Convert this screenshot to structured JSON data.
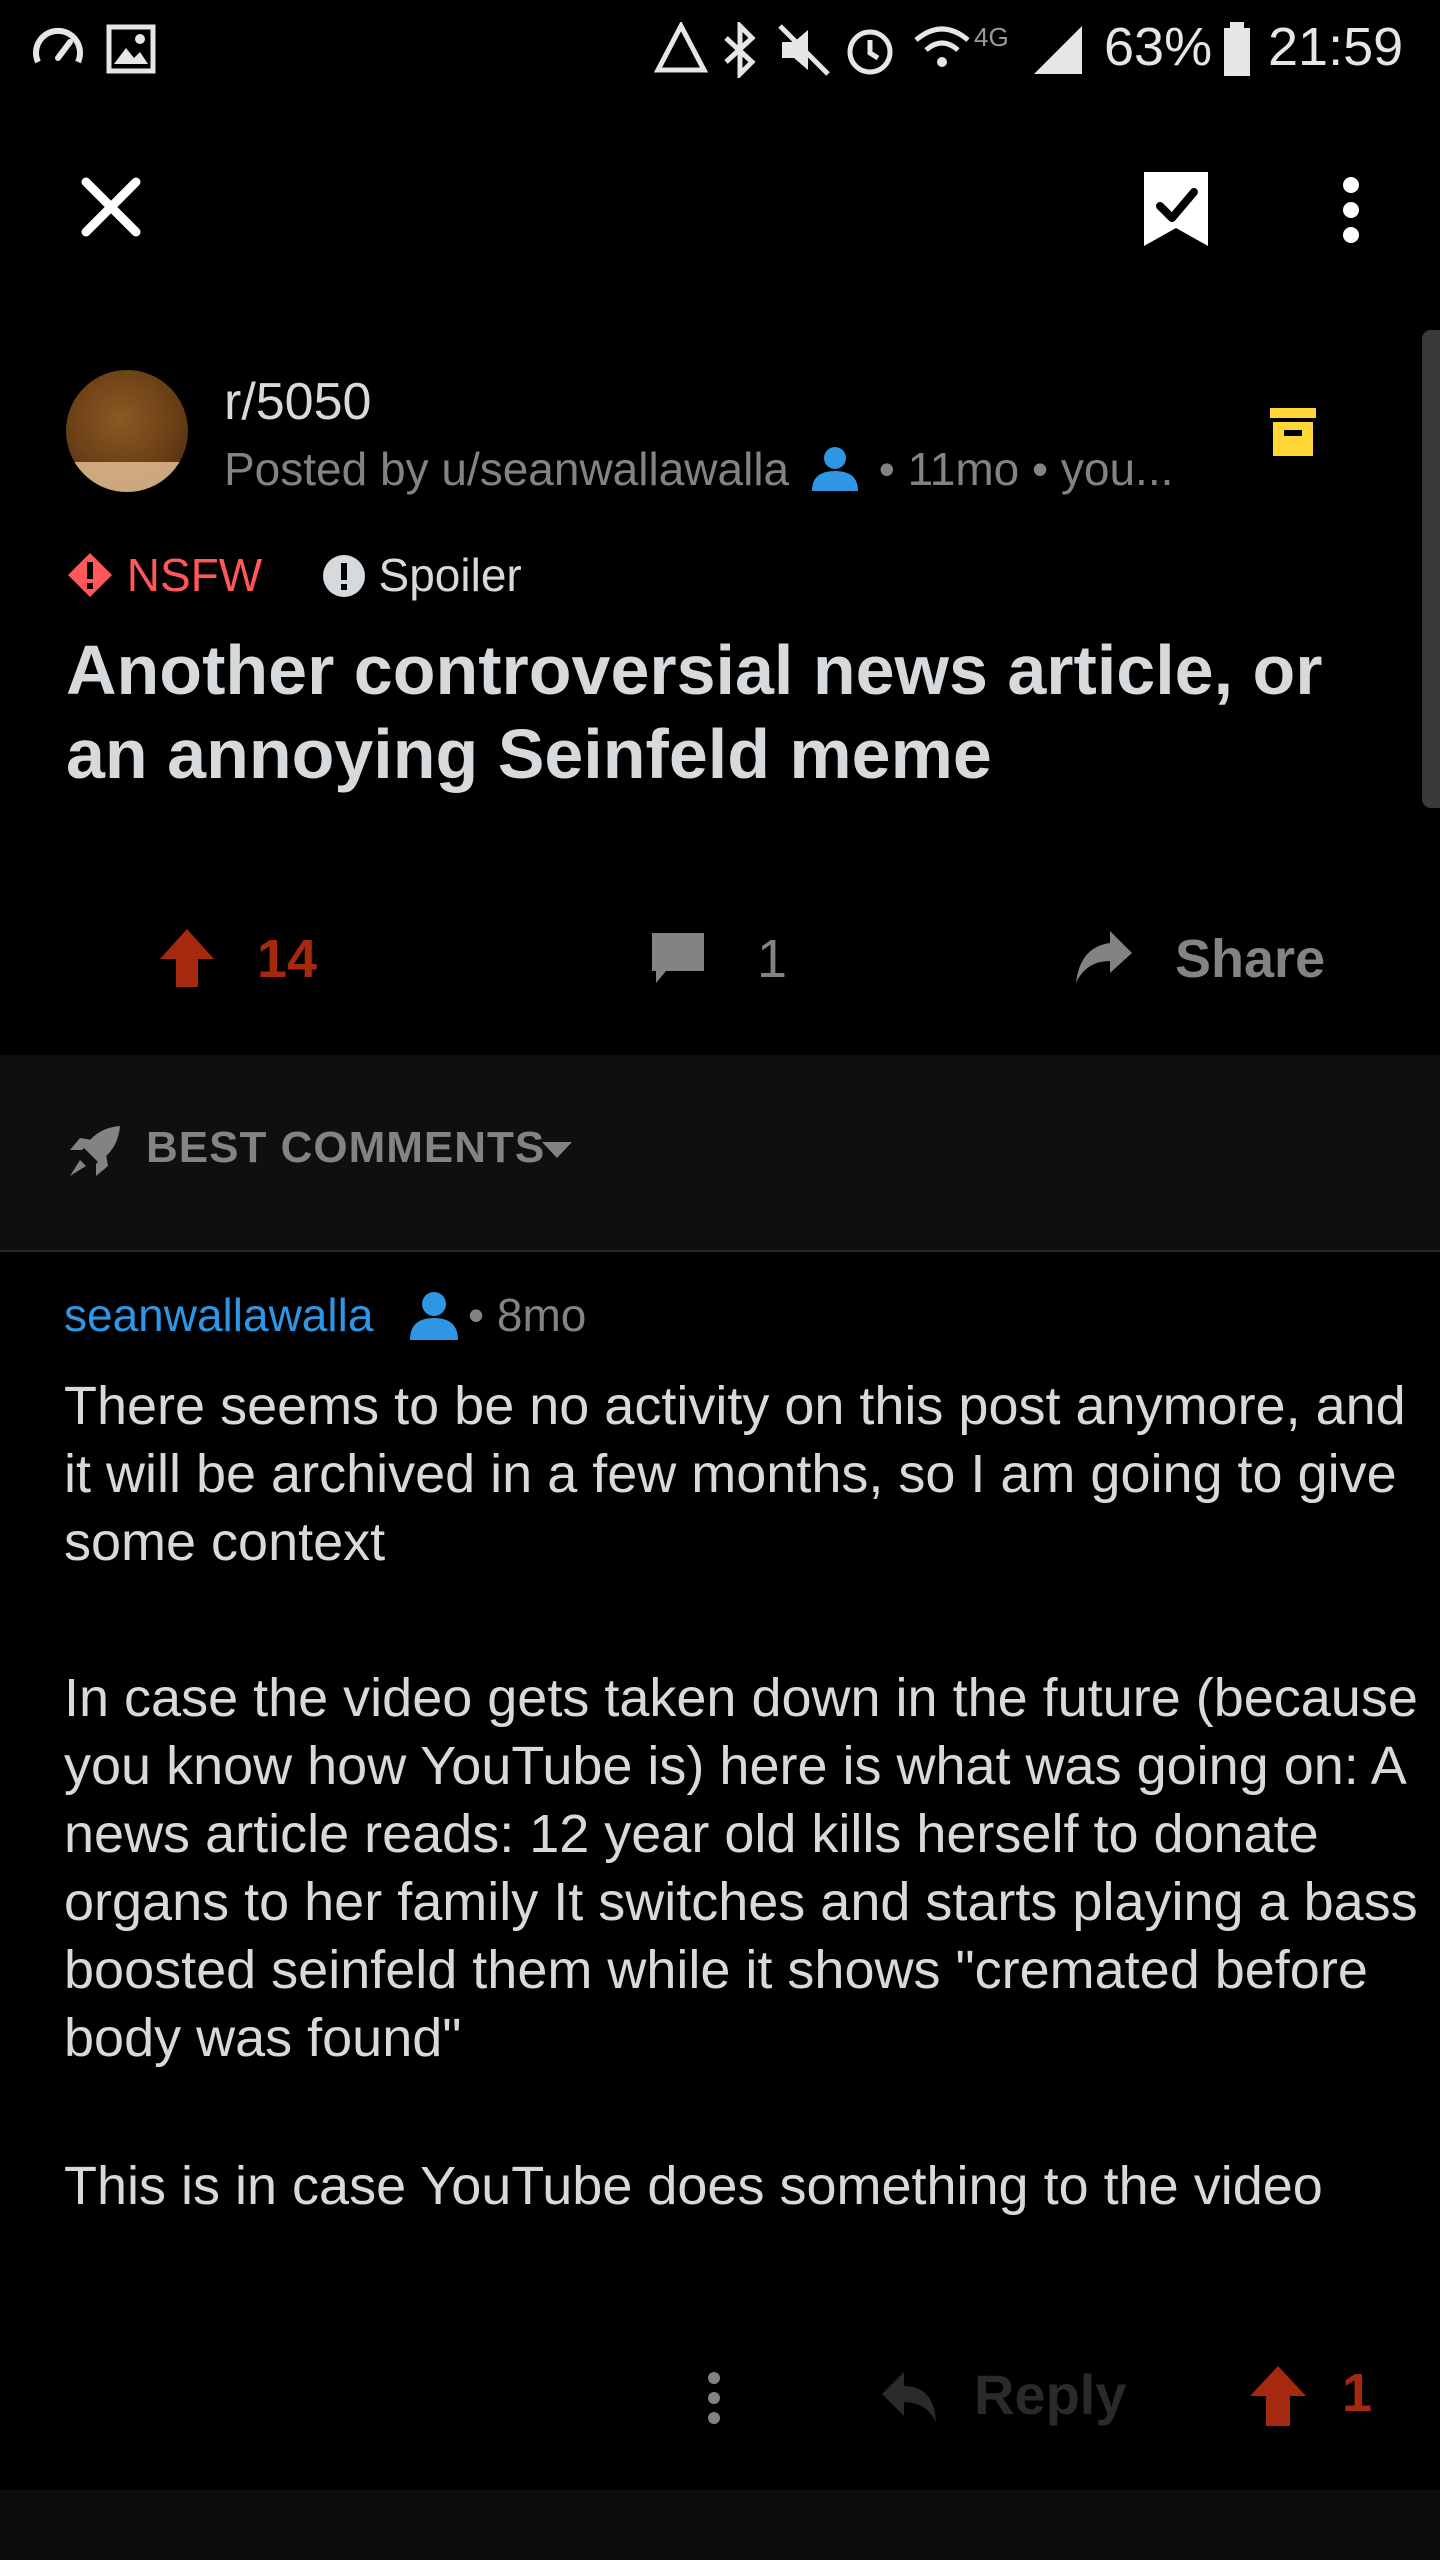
{
  "status_bar": {
    "battery": "63%",
    "time": "21:59",
    "network": "4G"
  },
  "post": {
    "subreddit": "r/5050",
    "posted_by": "Posted by u/seanwallawalla",
    "age": "• 11mo • you...",
    "tags": {
      "nsfw": "NSFW",
      "spoiler": "Spoiler"
    },
    "title": "Another controversial news article, or an annoying Seinfeld meme",
    "votes": "14",
    "comments": "1",
    "share_label": "Share"
  },
  "comments_section": {
    "sort_label": "BEST COMMENTS"
  },
  "comment": {
    "author": "seanwallawalla",
    "age": "• 8mo",
    "paragraphs": [
      "There seems to be no activity on this post anymore, and it will be archived in a few months, so I am going to give some context",
      "In case the video gets taken down in the future (because you know how YouTube is) here is what was going on: A news article reads: 12 year old kills herself to donate organs to her family It switches and starts playing a bass boosted seinfeld them while it shows \"cremated before body was found\"",
      "This is in case YouTube does something to the video"
    ],
    "reply_label": "Reply",
    "votes": "1"
  },
  "colors": {
    "background": "#000000",
    "upvote": "#a4290f",
    "username_blue": "#2f96e6",
    "nsfw_red": "#ff585b",
    "archive_yellow": "#ffd635"
  }
}
